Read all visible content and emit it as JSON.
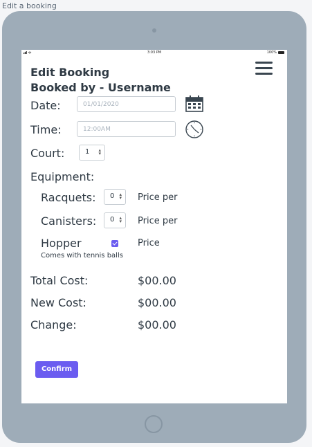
{
  "frame_title": "Edit a booking",
  "status_bar": {
    "time": "3:03 PM",
    "battery": "100%"
  },
  "header": {
    "title": "Edit Booking",
    "subtitle": "Booked by - Username"
  },
  "form": {
    "date_label": "Date:",
    "date_placeholder": "01/01/2020",
    "time_label": "Time:",
    "time_placeholder": "12:00AM",
    "court_label": "Court:",
    "court_value": "1",
    "equipment_label": "Equipment:",
    "racquets_label": "Racquets:",
    "racquets_value": "0",
    "racquets_price": "Price per",
    "canisters_label": "Canisters:",
    "canisters_value": "0",
    "canisters_price": "Price per",
    "hopper_label": "Hopper",
    "hopper_checked": true,
    "hopper_price": "Price",
    "hopper_note": "Comes with tennis balls"
  },
  "costs": {
    "total_label": "Total Cost:",
    "total_value": "$00.00",
    "new_label": "New Cost:",
    "new_value": "$00.00",
    "change_label": "Change:",
    "change_value": "$00.00"
  },
  "confirm_label": "Confirm",
  "colors": {
    "accent": "#6b5cf0",
    "tablet": "#9eacb8",
    "text": "#2f3a44"
  },
  "icons": {
    "date": "calendar-icon",
    "time": "clock-icon",
    "menu": "hamburger-menu-icon"
  }
}
